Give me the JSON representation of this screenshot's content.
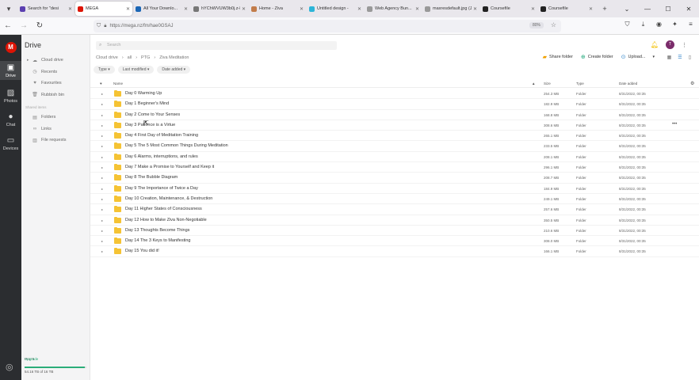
{
  "browser": {
    "tabs": [
      {
        "title": "Search for \"desi",
        "color": "#5b3fb0"
      },
      {
        "title": "MEGA",
        "color": "#dd1405",
        "active": true
      },
      {
        "title": "All Your Downlo...",
        "color": "#1b66b5"
      },
      {
        "title": "hYChWVUW3b0j.z-D...",
        "color": "#777777"
      },
      {
        "title": "Home - Ziva",
        "color": "#c27c4a"
      },
      {
        "title": "Untitled design -",
        "color": "#2db5d8"
      },
      {
        "title": "Web Agency Bun...",
        "color": "#999999"
      },
      {
        "title": "maxresdefault.jpg (JP...",
        "color": "#999999"
      },
      {
        "title": "Coursefile",
        "color": "#222222"
      },
      {
        "title": "Coursefile",
        "color": "#222222"
      }
    ],
    "url": "https://mega.nz/fm/hae0GSAJ",
    "zoom": "80%"
  },
  "rail": {
    "items": [
      {
        "label": "Drive",
        "icon": "drive-icon"
      },
      {
        "label": "Photos",
        "icon": "photos-icon"
      },
      {
        "label": "Chat",
        "icon": "chat-icon"
      },
      {
        "label": "Devices",
        "icon": "devices-icon"
      }
    ]
  },
  "sidebar": {
    "title": "Drive",
    "items": [
      {
        "label": "Cloud drive",
        "icon": "cloud-icon"
      },
      {
        "label": "Recents",
        "icon": "clock-icon"
      },
      {
        "label": "Favourites",
        "icon": "heart-icon"
      },
      {
        "label": "Rubbish bin",
        "icon": "trash-icon"
      }
    ],
    "shared_heading": "Shared items",
    "shared": [
      {
        "label": "Folders",
        "icon": "shared-folder-icon"
      },
      {
        "label": "Links",
        "icon": "link-icon"
      },
      {
        "label": "File requests",
        "icon": "file-request-icon"
      }
    ],
    "plan": {
      "name": "Pro III",
      "upgrade": "Upgrade",
      "usage": "54.16 TB of 16 TB",
      "fill": 0.98
    }
  },
  "main": {
    "search_placeholder": "Search",
    "avatar": "T",
    "breadcrumb": [
      "Cloud drive",
      "all",
      "PTG",
      "Ziva Meditation"
    ],
    "actions": {
      "share": "Share folder",
      "create": "Create folder",
      "upload": "Upload..."
    },
    "filters": [
      "Type",
      "Last modified",
      "Date added"
    ],
    "columns": {
      "name": "Name",
      "size": "Size",
      "type": "Type",
      "date": "Date added"
    },
    "rows": [
      {
        "name": "Day 0 Warming Up",
        "size": "254.3 MB",
        "type": "Folder",
        "date": "8/31/2022, 00:35"
      },
      {
        "name": "Day 1 Beginner's Mind",
        "size": "182.9 MB",
        "type": "Folder",
        "date": "8/31/2022, 00:35"
      },
      {
        "name": "Day 2 Come to Your Senses",
        "size": "168.8 MB",
        "type": "Folder",
        "date": "8/31/2022, 00:35"
      },
      {
        "name": "Day 3 Patience is a Virtue",
        "size": "308.6 MB",
        "type": "Folder",
        "date": "8/31/2022, 00:35"
      },
      {
        "name": "Day 4 First Day of Meditation Training",
        "size": "265.1 MB",
        "type": "Folder",
        "date": "8/31/2022, 00:35"
      },
      {
        "name": "Day 5 The 5 Most Common Things During Meditation",
        "size": "233.5 MB",
        "type": "Folder",
        "date": "8/31/2022, 00:35"
      },
      {
        "name": "Day 6 Alarms, interruptions, and rules",
        "size": "208.1 MB",
        "type": "Folder",
        "date": "8/31/2022, 00:35"
      },
      {
        "name": "Day 7 Make a Promise to Yourself and Keep it",
        "size": "296.1 MB",
        "type": "Folder",
        "date": "8/31/2022, 00:35"
      },
      {
        "name": "Day 8 The Bubble Diagram",
        "size": "208.7 MB",
        "type": "Folder",
        "date": "8/31/2022, 00:35"
      },
      {
        "name": "Day 9 The Importance of Twice a Day",
        "size": "184.9 MB",
        "type": "Folder",
        "date": "8/31/2022, 00:35"
      },
      {
        "name": "Day 10 Creation, Maintenance, & Destruction",
        "size": "249.1 MB",
        "type": "Folder",
        "date": "8/31/2022, 00:35"
      },
      {
        "name": "Day 11 Higher States of Consciousness",
        "size": "257.6 MB",
        "type": "Folder",
        "date": "8/31/2022, 00:35"
      },
      {
        "name": "Day 12 How to Make Ziva Non-Negotiable",
        "size": "350.5 MB",
        "type": "Folder",
        "date": "8/31/2022, 00:35"
      },
      {
        "name": "Day 13 Thoughts Become Things",
        "size": "210.6 MB",
        "type": "Folder",
        "date": "8/31/2022, 00:35"
      },
      {
        "name": "Day 14 The 3 Keys to Manifesting",
        "size": "308.0 MB",
        "type": "Folder",
        "date": "8/31/2022, 00:35"
      },
      {
        "name": "Day 15 You did it!",
        "size": "166.1 MB",
        "type": "Folder",
        "date": "8/31/2022, 00:35"
      }
    ]
  }
}
